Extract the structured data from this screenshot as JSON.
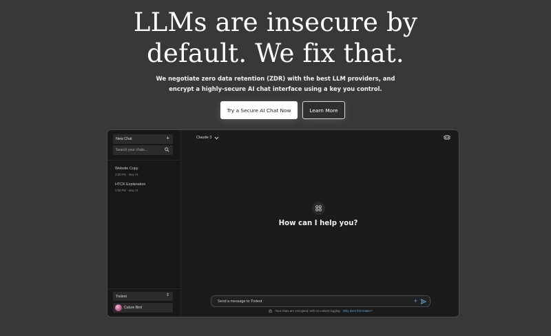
{
  "hero": {
    "title_line1": "LLMs are insecure by",
    "title_line2": "default. We fix that.",
    "subtitle_line1": "We negotiate zero data retention (ZDR) with the best LLM providers, and",
    "subtitle_line2": "encrypt a highly-secure AI chat interface using a key you control.",
    "cta_primary": "Try a Secure AI Chat Now",
    "cta_secondary": "Learn More"
  },
  "app": {
    "sidebar": {
      "new_chat_label": "New Chat",
      "search_placeholder": "Search your chats...",
      "chats": [
        {
          "title": "Website Copy",
          "time": "3:50 PM · May 31"
        },
        {
          "title": "HTCK Explanation",
          "time": "3:50 PM · May 31"
        }
      ],
      "model_select_value": "Trelent",
      "user_name": "Calure Bird"
    },
    "main": {
      "model_picker_label": "Claude 3",
      "greeting": "How can I help you?",
      "input_placeholder": "Send a message to Trelent",
      "footer_text": "Your chats are encrypted, with no content logging.",
      "footer_link": "Why does this matter?"
    }
  },
  "colors": {
    "page_background": "#383838",
    "app_background": "#1b1b1b",
    "accent": "#5fb0d8"
  },
  "icons": {
    "plus": "plus-icon",
    "search": "search-icon",
    "chevron": "chevron-down-icon",
    "updown": "chevron-updown-icon",
    "grid": "grid-icon",
    "send": "send-icon",
    "lock": "lock-icon",
    "mask": "mask-icon"
  }
}
